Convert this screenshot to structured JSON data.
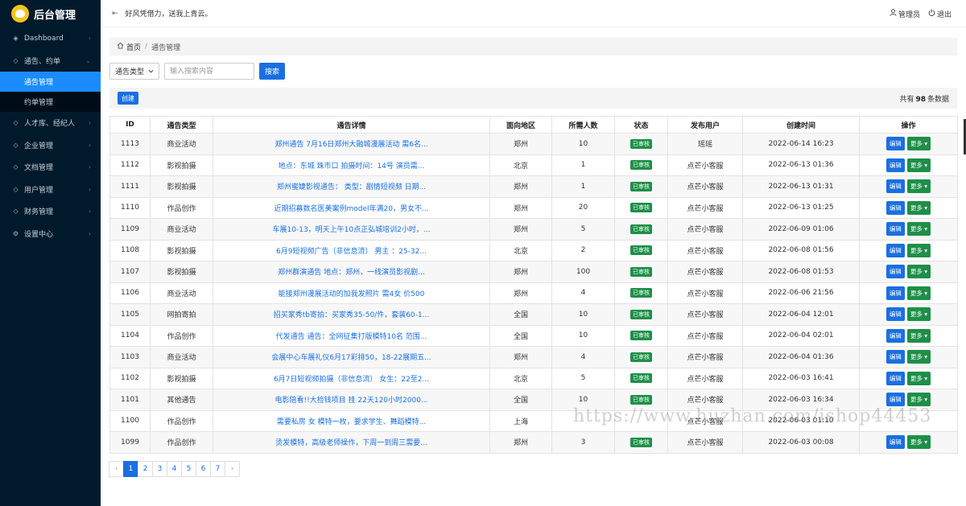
{
  "app": {
    "title": "后台管理",
    "slogan": "好风凭借力，送我上青云。"
  },
  "header": {
    "user_label": "管理员",
    "logout_label": "退出"
  },
  "sidebar": {
    "items": [
      {
        "label": "Dashboard",
        "icon": "dashboard-icon"
      },
      {
        "label": "通告、约单",
        "icon": "cube-icon",
        "children": [
          {
            "label": "通告管理",
            "active": true
          },
          {
            "label": "约单管理",
            "active": false
          }
        ]
      },
      {
        "label": "人才库、经纪人",
        "icon": "cube-icon"
      },
      {
        "label": "企业管理",
        "icon": "cube-icon"
      },
      {
        "label": "文档管理",
        "icon": "cube-icon"
      },
      {
        "label": "用户管理",
        "icon": "cube-icon"
      },
      {
        "label": "财务管理",
        "icon": "cube-icon"
      },
      {
        "label": "设置中心",
        "icon": "gear-icon"
      }
    ]
  },
  "breadcrumb": {
    "home": "首页",
    "current": "通告管理"
  },
  "filter": {
    "type_select": "通告类型",
    "search_placeholder": "输入搜索内容",
    "search_button": "搜索"
  },
  "actions": {
    "create_button": "创建",
    "total_prefix": "共有",
    "total_count": "98",
    "total_suffix": "条数据"
  },
  "table": {
    "columns": [
      "ID",
      "通告类型",
      "通告详情",
      "面向地区",
      "所需人数",
      "状态",
      "发布用户",
      "创建时间",
      "操作"
    ],
    "edit_label": "编辑",
    "more_label": "更多",
    "rows": [
      {
        "id": "1113",
        "type": "商业活动",
        "detail": "郑州通告 7月16日郑州大融城漫展活动 需6名...",
        "region": "郑州",
        "count": "10",
        "status": "已审核",
        "user": "瑶瑶",
        "created": "2022-06-14 16:23"
      },
      {
        "id": "1112",
        "type": "影视拍摄",
        "detail": "地点：东城 珠市口 拍摄时间：14号 演员需...",
        "region": "北京",
        "count": "1",
        "status": "已审核",
        "user": "点芒小客服",
        "created": "2022-06-13 01:36"
      },
      {
        "id": "1111",
        "type": "影视拍摄",
        "detail": "郑州蜜婕影视通告： 类型：剧情短视频 日期...",
        "region": "郑州",
        "count": "1",
        "status": "已审核",
        "user": "点芒小客服",
        "created": "2022-06-13 01:31"
      },
      {
        "id": "1110",
        "type": "作品创作",
        "detail": "近期招募数名医美案例model年满20，男女不...",
        "region": "郑州",
        "count": "20",
        "status": "已审核",
        "user": "点芒小客服",
        "created": "2022-06-13 01:25"
      },
      {
        "id": "1109",
        "type": "商业活动",
        "detail": "车展10-13，明天上午10点正弘城培训2小时，...",
        "region": "郑州",
        "count": "5",
        "status": "已审核",
        "user": "点芒小客服",
        "created": "2022-06-09 01:06"
      },
      {
        "id": "1108",
        "type": "影视拍摄",
        "detail": "6月9短视频广告（非信息流） 男主 ：25-32...",
        "region": "北京",
        "count": "2",
        "status": "已审核",
        "user": "点芒小客服",
        "created": "2022-06-08 01:56"
      },
      {
        "id": "1107",
        "type": "影视拍摄",
        "detail": "郑州群演通告 地点：郑州，一线演员影视剧...",
        "region": "郑州",
        "count": "100",
        "status": "已审核",
        "user": "点芒小客服",
        "created": "2022-06-08 01:53"
      },
      {
        "id": "1106",
        "type": "商业活动",
        "detail": "能接郑州漫展活动的加我发照片 需4女 价500",
        "region": "郑州",
        "count": "4",
        "status": "已审核",
        "user": "点芒小客服",
        "created": "2022-06-06 21:56"
      },
      {
        "id": "1105",
        "type": "网拍寄拍",
        "detail": "招买家秀tb寄拍：买家秀35-50/件，套装60-1...",
        "region": "全国",
        "count": "10",
        "status": "已审核",
        "user": "点芒小客服",
        "created": "2022-06-04 12:01"
      },
      {
        "id": "1104",
        "type": "作品创作",
        "detail": "代发通告 通告：全网征集打版模特10名 范围...",
        "region": "全国",
        "count": "10",
        "status": "已审核",
        "user": "点芒小客服",
        "created": "2022-06-04 02:01"
      },
      {
        "id": "1103",
        "type": "商业活动",
        "detail": "会展中心车展礼仪6月17彩排50，18-22展期五...",
        "region": "郑州",
        "count": "4",
        "status": "已审核",
        "user": "点芒小客服",
        "created": "2022-06-04 01:36"
      },
      {
        "id": "1102",
        "type": "影视拍摄",
        "detail": "6月7日短视频拍摄（非信息流） 女生：22至2...",
        "region": "北京",
        "count": "5",
        "status": "已审核",
        "user": "点芒小客服",
        "created": "2022-06-03 16:41"
      },
      {
        "id": "1101",
        "type": "其他通告",
        "detail": "电影陪看!!大捡钱项目 挂 22天120小时2000...",
        "region": "全国",
        "count": "10",
        "status": "已审核",
        "user": "点芒小客服",
        "created": "2022-06-03 16:34"
      },
      {
        "id": "1100",
        "type": "作品创作",
        "detail": "需要私房 女 模特一枚，要求学生、舞蹈模特...",
        "region": "上海",
        "count": "",
        "status": "",
        "user": "点芒小客服",
        "created": "2022-06-03 01:10"
      },
      {
        "id": "1099",
        "type": "作品创作",
        "detail": "烫发模特，高级老师操作，下周一到周三需要...",
        "region": "郑州",
        "count": "3",
        "status": "已审核",
        "user": "点芒小客服",
        "created": "2022-06-03 00:08"
      }
    ]
  },
  "pagination": {
    "prev": "‹",
    "next": "›",
    "pages": [
      "1",
      "2",
      "3",
      "4",
      "5",
      "6",
      "7"
    ],
    "current": "1"
  },
  "watermark": "https://www.huzhan.com/ishop44453"
}
